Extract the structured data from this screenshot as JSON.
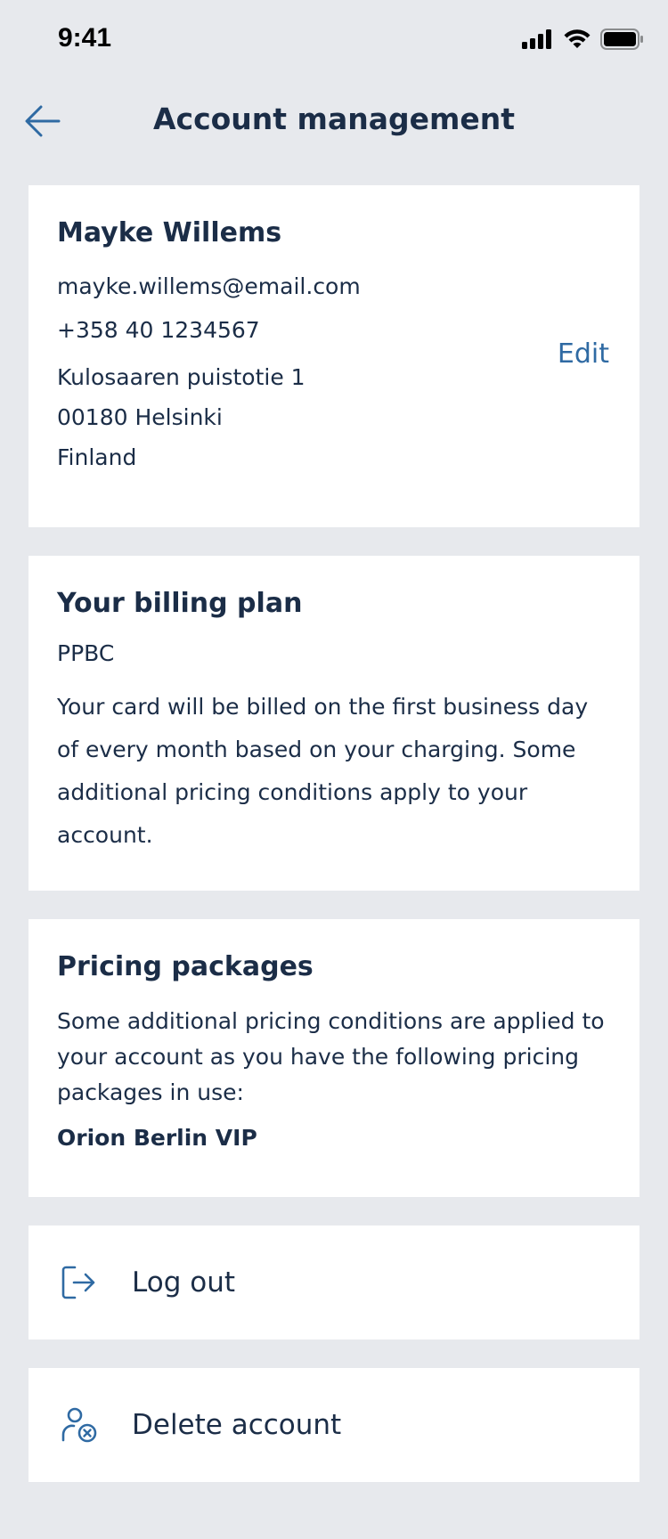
{
  "status_bar": {
    "time": "9:41"
  },
  "header": {
    "title": "Account management"
  },
  "profile": {
    "name": "Mayke Willems",
    "email": "mayke.willems@email.com",
    "phone": "+358 40 1234567",
    "address_line1": "Kulosaaren puistotie 1",
    "address_line2": "00180 Helsinki",
    "address_line3": "Finland",
    "edit_label": "Edit"
  },
  "billing": {
    "title": "Your billing plan",
    "plan": "PPBC",
    "description": "Your card will be billed on the first business day of every month based on your charging. Some additional pricing conditions apply to your account."
  },
  "pricing": {
    "title": "Pricing packages",
    "description": "Some additional pricing conditions are applied to your account as you have the following pricing packages in use:",
    "package": "Orion Berlin VIP"
  },
  "actions": {
    "logout_label": "Log out",
    "delete_label": "Delete account"
  },
  "colors": {
    "background": "#e7e9ed",
    "text": "#1b2d47",
    "accent": "#2f6aa3"
  }
}
